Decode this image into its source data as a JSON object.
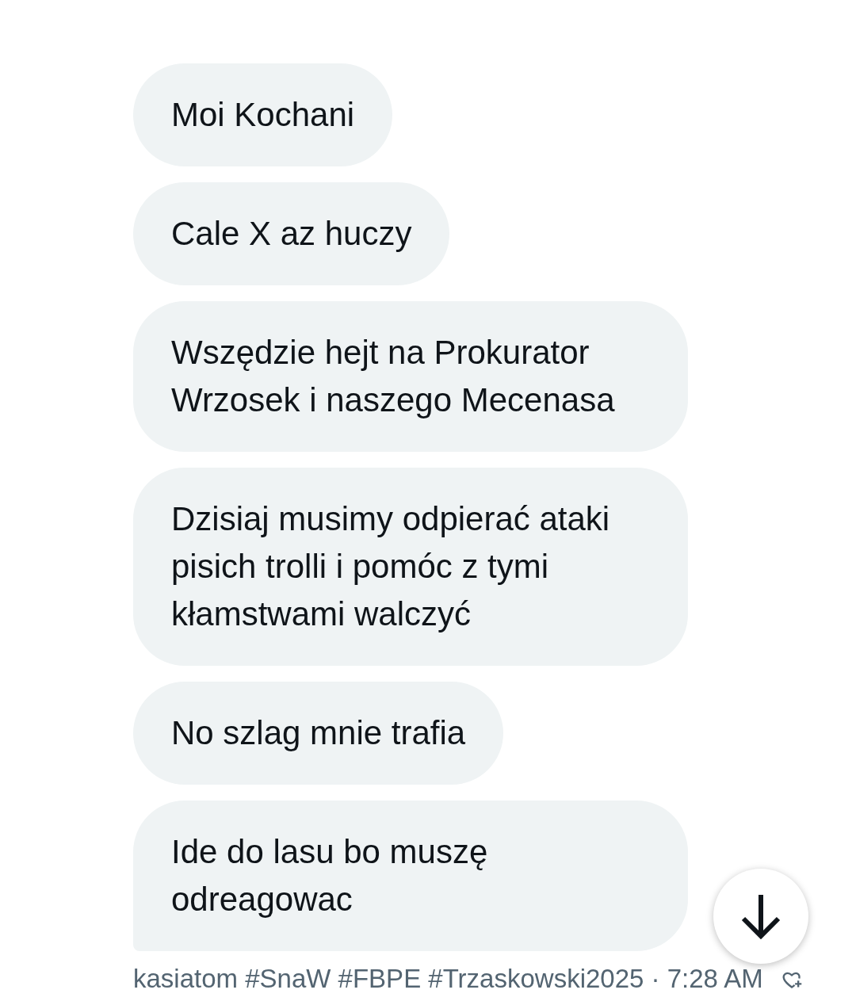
{
  "messages": [
    {
      "text": "Moi Kochani",
      "tail": false
    },
    {
      "text": "Cale X az huczy",
      "tail": false
    },
    {
      "text": "Wszędzie hejt na Prokurator Wrzosek i naszego Mecenasa",
      "tail": false
    },
    {
      "text": "Dzisiaj musimy odpierać ataki pisich trolli i pomóc z tymi kłamstwami walczyć",
      "tail": false
    },
    {
      "text": "No szlag mnie trafia",
      "tail": false
    },
    {
      "text": "Ide do lasu bo muszę odreagowac",
      "tail": true
    }
  ],
  "footer": {
    "meta": "kasiatom #SnaW #FBPE #Trzaskowski2025 · 7:28 AM"
  }
}
